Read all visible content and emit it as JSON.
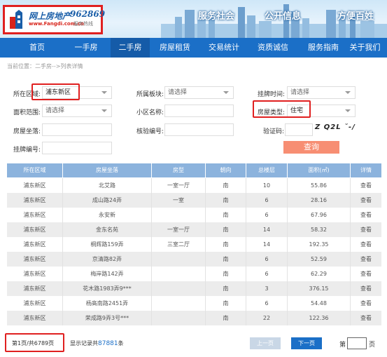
{
  "header": {
    "logo_cn": "网上房地产",
    "logo_num": "962869",
    "logo_url": "www.Fangdi.com.cn",
    "logo_sub": "服务热线",
    "slogans": [
      "服务社会",
      "公开信息",
      "方便百姓"
    ]
  },
  "nav": {
    "items": [
      {
        "label": "首页"
      },
      {
        "label": "一手房"
      },
      {
        "label": "二手房"
      },
      {
        "label": "房屋租赁"
      },
      {
        "label": "交易统计"
      },
      {
        "label": "资质诚信"
      },
      {
        "label": "服务指南"
      },
      {
        "label": "关于我们"
      }
    ],
    "active_index": 2
  },
  "breadcrumb": "当前位置：二手房-->列表详情",
  "form": {
    "district_label": "所在区域:",
    "district_value": "浦东新区",
    "block_label": "所属板块:",
    "block_value": "请选择",
    "listing_time_label": "挂牌时间:",
    "listing_time_value": "请选择",
    "area_label": "面积范围:",
    "area_value": "请选择",
    "community_label": "小区名称:",
    "house_type_label": "房屋类型:",
    "house_type_value": "住宅",
    "address_label": "房屋坐落:",
    "verify_no_label": "核验编号:",
    "captcha_label": "验证码:",
    "captcha_text": "Z Q2L ˘-/",
    "listing_no_label": "挂牌编号:",
    "search_label": "查询"
  },
  "table": {
    "headers": [
      "所在区域",
      "房屋坐落",
      "房型",
      "朝向",
      "总楼层",
      "面积(㎡)",
      "详情"
    ],
    "rows": [
      [
        "浦东新区",
        "北艾路",
        "一室一厅",
        "南",
        "10",
        "55.86",
        "查看"
      ],
      [
        "浦东新区",
        "成山路24弄",
        "一室",
        "南",
        "6",
        "28.16",
        "查看"
      ],
      [
        "浦东新区",
        "永安新",
        "",
        "南",
        "6",
        "67.96",
        "查看"
      ],
      [
        "浦东新区",
        "金东名苑",
        "一室一厅",
        "南",
        "14",
        "58.32",
        "查看"
      ],
      [
        "浦东新区",
        "桐辉路159弄",
        "三室二厅",
        "南",
        "14",
        "192.35",
        "查看"
      ],
      [
        "浦东新区",
        "京清路82弄",
        "",
        "南",
        "6",
        "52.59",
        "查看"
      ],
      [
        "浦东新区",
        "梅岸路142弄",
        "",
        "南",
        "6",
        "62.29",
        "查看"
      ],
      [
        "浦东新区",
        "花木路1983弄9***",
        "",
        "南",
        "3",
        "376.15",
        "查看"
      ],
      [
        "浦东新区",
        "杨高南路2451弄",
        "",
        "南",
        "6",
        "54.48",
        "查看"
      ],
      [
        "浦东新区",
        "荣成路9弄3号***",
        "",
        "南",
        "22",
        "122.36",
        "查看"
      ]
    ]
  },
  "footer": {
    "page_info": "第1页/共6789页",
    "total_prefix": "显示记录共",
    "total_count": "87881",
    "total_suffix": "条",
    "prev_label": "上一页",
    "next_label": "下一页",
    "goto_prefix": "第",
    "goto_suffix": "页"
  },
  "colors": {
    "nav_bg": "#1b6fc7",
    "highlight_box": "#e02020",
    "search_button": "#f78e73",
    "table_header": "#8cb3dd",
    "next_button": "#1b6fc7",
    "prev_button": "#c9d7e6"
  }
}
